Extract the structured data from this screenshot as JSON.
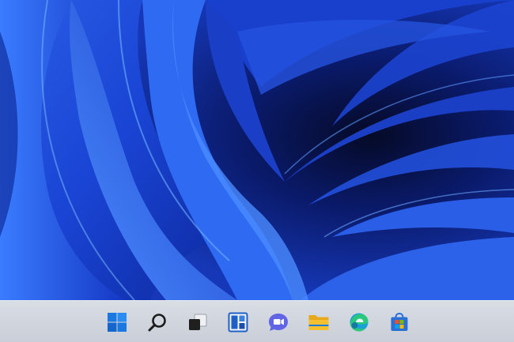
{
  "desktop": {
    "wallpaper": "windows-11-bloom-wallpaper",
    "colors": {
      "deep": "#071038",
      "mid": "#1336c8",
      "bright": "#2f6df0",
      "highlight": "#5a9bff"
    }
  },
  "taskbar": {
    "background": "#d3d8e0",
    "items": [
      {
        "icon": "windows-start-icon",
        "color": "#1a78e0"
      },
      {
        "icon": "search-icon",
        "color": "#1c1c1c"
      },
      {
        "icon": "task-view-icon",
        "color": "#222222"
      },
      {
        "icon": "widgets-icon",
        "color": "#1e5fc8"
      },
      {
        "icon": "teams-chat-icon",
        "color": "#6264e6"
      },
      {
        "icon": "file-explorer-icon",
        "color": "#f5c030"
      },
      {
        "icon": "edge-browser-icon",
        "color": "#1aa0d8"
      },
      {
        "icon": "microsoft-store-icon",
        "color": "#2a6fd6"
      }
    ]
  }
}
